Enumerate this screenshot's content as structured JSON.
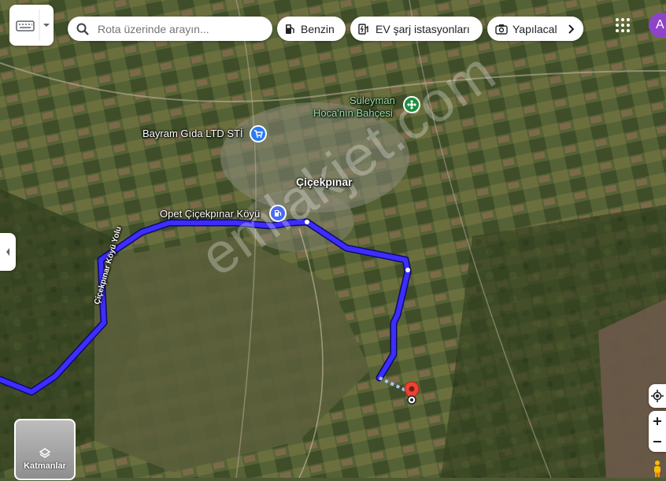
{
  "search": {
    "placeholder": "Rota üzerinde arayın..."
  },
  "chips": [
    {
      "label": "Benzin",
      "icon": "gas-pump-icon"
    },
    {
      "label": "EV şarj istasyonları",
      "icon": "ev-charger-icon"
    },
    {
      "label": "Yapılacal",
      "icon": "camera-icon"
    }
  ],
  "account": {
    "initial": "A"
  },
  "map_labels": {
    "bahce_line1": "Süleyman",
    "bahce_line2": "Hoca'nın Bahçesi",
    "market": "Bayram Gıda LTD STİ",
    "town": "Çiçekpınar",
    "fuel": "Opet Çiçekpınar Köyü",
    "road": "Çiçekpınar Köyü Yolu"
  },
  "layers": {
    "label": "Katmanlar"
  },
  "watermark": "emlakjet.com",
  "colors": {
    "route": "#3d2dff",
    "pin": "#ea4335",
    "fuel_poi": "#4a6cf7",
    "market_poi": "#2b7bf0",
    "garden_poi": "#1e8e3e"
  }
}
